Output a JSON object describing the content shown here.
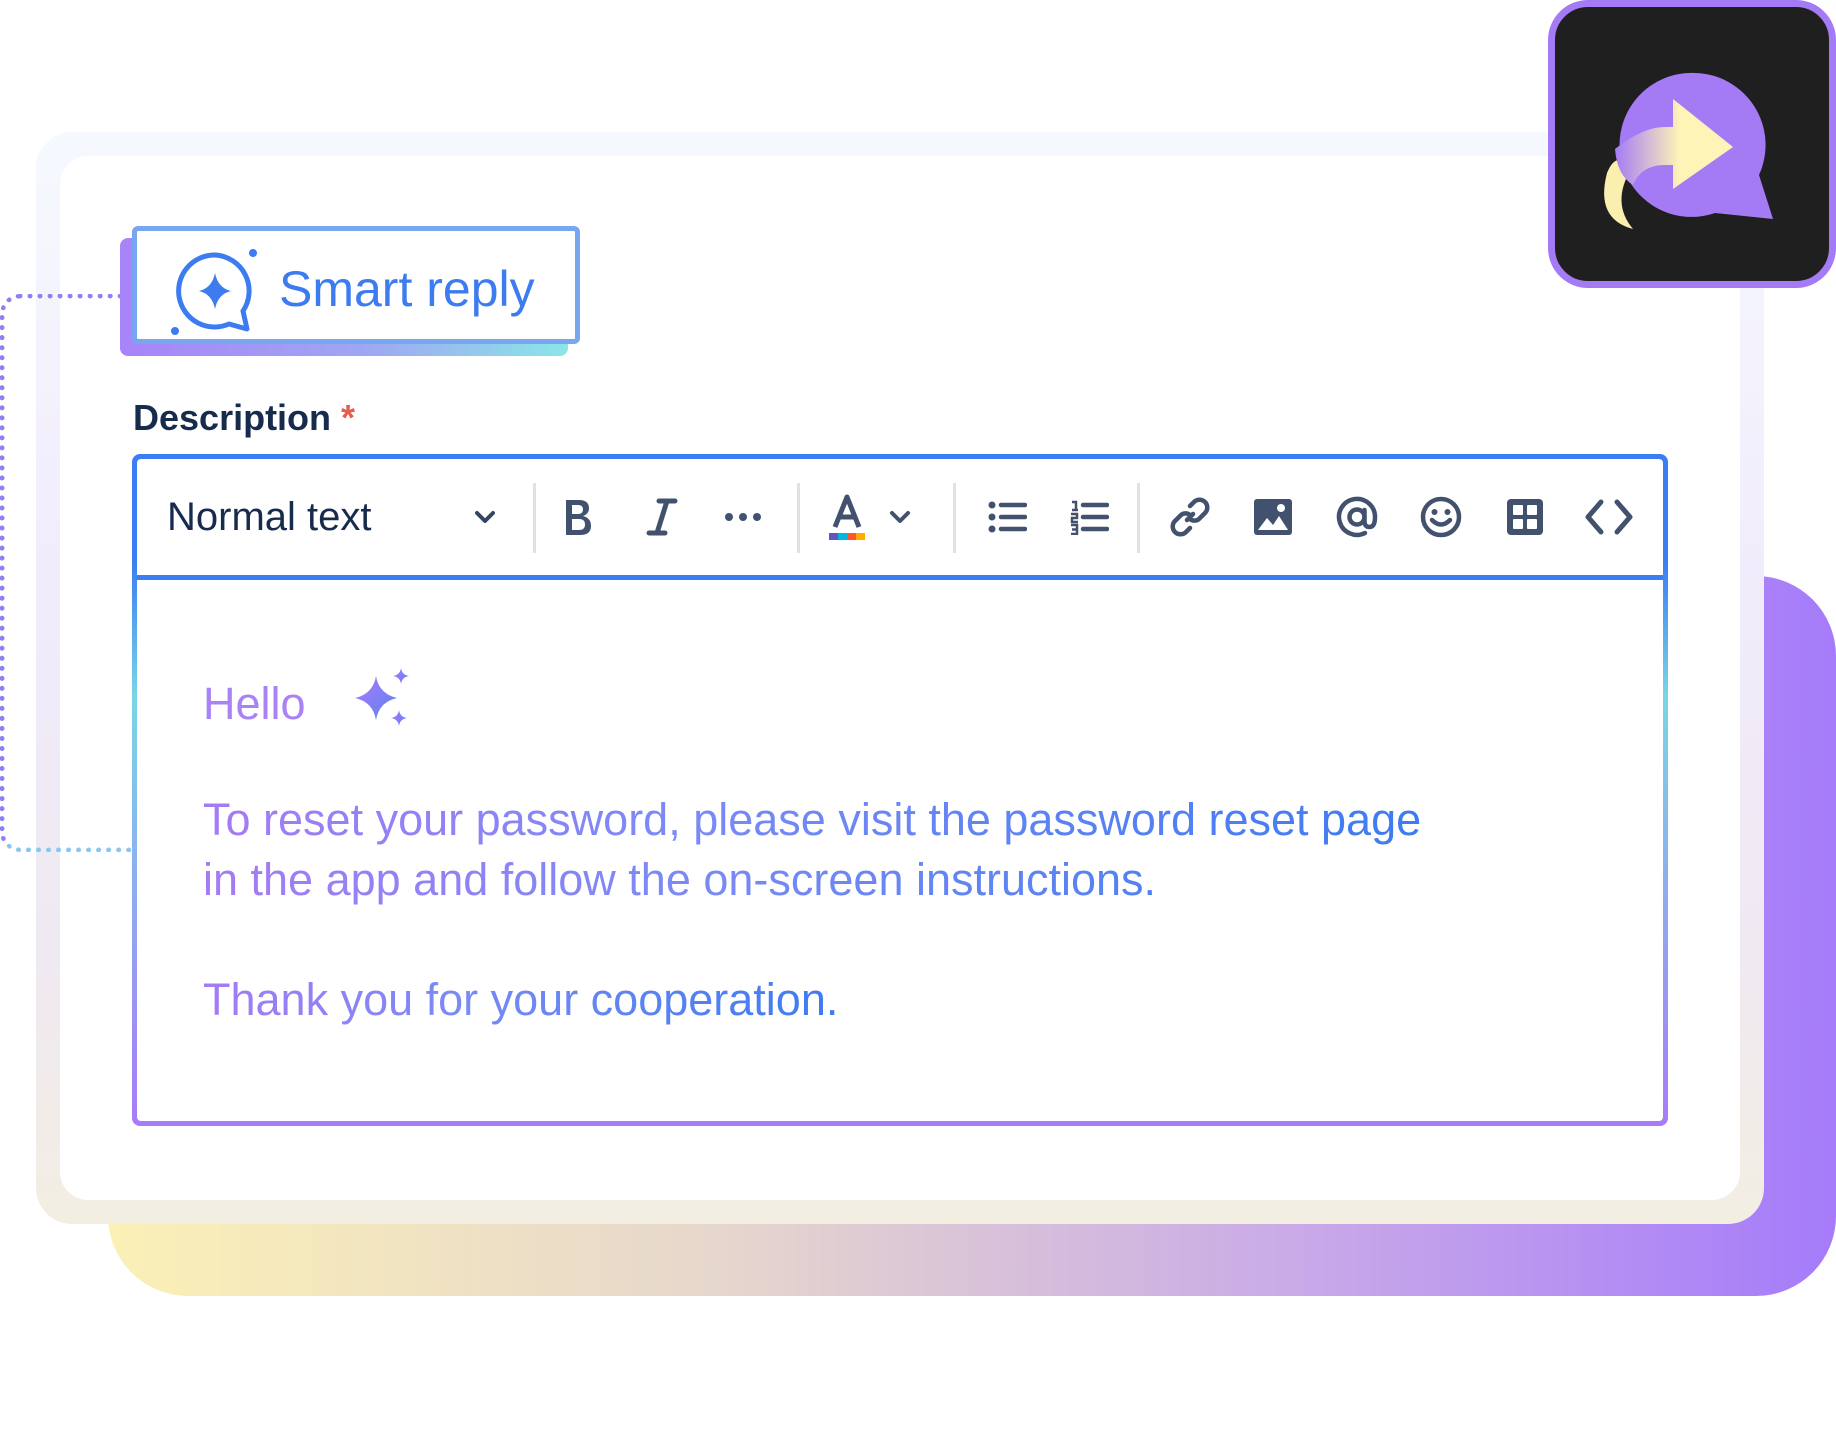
{
  "badge": {
    "label": "Smart reply",
    "icon": "smart-reply-sparkle-chat-icon"
  },
  "field": {
    "label": "Description",
    "required_mark": "*"
  },
  "toolbar": {
    "text_style": "Normal text",
    "buttons": [
      {
        "name": "bold",
        "icon": "bold-icon"
      },
      {
        "name": "italic",
        "icon": "italic-icon"
      },
      {
        "name": "more-formatting",
        "icon": "more-icon"
      },
      {
        "name": "text-color",
        "icon": "text-color-icon"
      },
      {
        "name": "bullet-list",
        "icon": "bullet-list-icon"
      },
      {
        "name": "numbered-list",
        "icon": "numbered-list-icon"
      },
      {
        "name": "link",
        "icon": "link-icon"
      },
      {
        "name": "image",
        "icon": "image-icon"
      },
      {
        "name": "mention",
        "icon": "mention-icon"
      },
      {
        "name": "emoji",
        "icon": "emoji-icon"
      },
      {
        "name": "table",
        "icon": "table-icon"
      },
      {
        "name": "code",
        "icon": "code-icon"
      }
    ]
  },
  "editor": {
    "greeting": "Hello",
    "body_line1": "To reset your password, please visit the password reset page",
    "body_line2": "in the app and follow the on-screen instructions.",
    "closing": "Thank you for your cooperation."
  },
  "colors": {
    "accent_blue": "#3b7df3",
    "accent_purple": "#a57bf5",
    "text_dark": "#172b4d",
    "required_red": "#e45d4f",
    "tile_bg": "#1f1f1f"
  }
}
